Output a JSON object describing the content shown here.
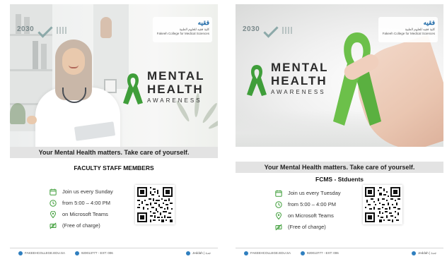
{
  "colors": {
    "ribbon_green": "#3f9e3a",
    "ribbon_light": "#6cc04a",
    "icon_green": "#3f9e3a",
    "band_gray": "#e3e3e3",
    "brand_blue": "#1f6aa8"
  },
  "posters": [
    {
      "vision": "2030",
      "logo": {
        "word": "فقيه",
        "arabic": "كلية فقيه للعلوم الطبية",
        "english": "Fakeeh College for Medical Sciences"
      },
      "title": {
        "line1": "MENTAL",
        "line2": "HEALTH",
        "line3": "AWARENESS"
      },
      "tagline": "Your Mental Health matters. Take care of yourself.",
      "audience": "FACULTY STAFF MEMBERS",
      "info": [
        {
          "icon": "calendar-icon",
          "text": "Join us every Sunday"
        },
        {
          "icon": "clock-icon",
          "text": "from 5:00 – 4:00 PM"
        },
        {
          "icon": "location-pin-icon",
          "text": "on Microsoft Teams"
        },
        {
          "icon": "no-money-icon",
          "text": "(Free of charge)"
        }
      ],
      "footer": {
        "website": "FAKEEHCOLLEGE.EDU.SA",
        "phone": "920013777 - EXT: 006",
        "location": "Jeddah | جدة"
      }
    },
    {
      "vision": "2030",
      "logo": {
        "word": "فقيه",
        "arabic": "كلية فقيه للعلوم الطبية",
        "english": "Fakeeh College for Medical Sciences"
      },
      "title": {
        "line1": "MENTAL",
        "line2": "HEALTH",
        "line3": "AWARENESS"
      },
      "tagline": "Your Mental Health matters. Take care of yourself.",
      "audience": "FCMS  - Stduents",
      "info": [
        {
          "icon": "calendar-icon",
          "text": "Join us every Tuesday"
        },
        {
          "icon": "clock-icon",
          "text": "from 5:00 – 4:00 PM"
        },
        {
          "icon": "location-pin-icon",
          "text": "on Microsoft Teams"
        },
        {
          "icon": "no-money-icon",
          "text": "(Free of charge)"
        }
      ],
      "footer": {
        "website": "FAKEEHCOLLEGE.EDU.SA",
        "phone": "920013777 - EXT: 006",
        "location": "Jeddah | جدة"
      }
    }
  ]
}
